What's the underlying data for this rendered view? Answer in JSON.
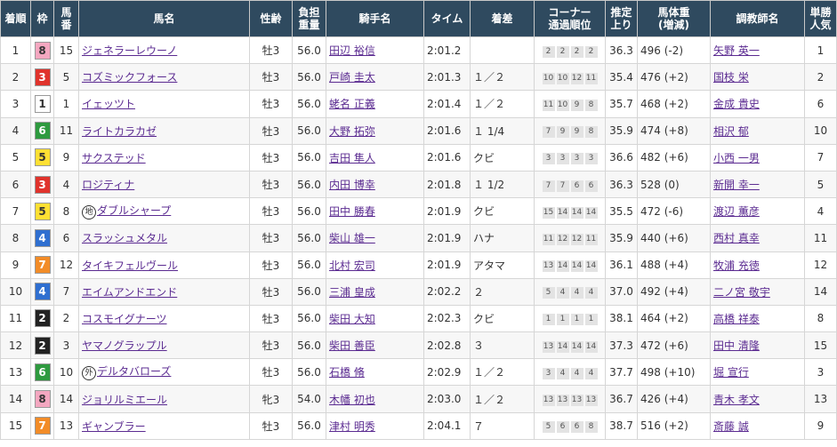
{
  "headers": {
    "rank": "着順",
    "waku": "枠",
    "umaban": "馬\n番",
    "horse": "馬名",
    "sexage": "性齢",
    "weight": "負担\n重量",
    "jockey": "騎手名",
    "time": "タイム",
    "margin": "着差",
    "corner": "コーナー\n通過順位",
    "last3f": "推定\n上り",
    "bodyweight": "馬体重\n(増減)",
    "trainer": "調教師名",
    "pop": "単勝\n人気"
  },
  "waku_colors": {
    "1": {
      "bg": "#ffffff",
      "fg": "#333333"
    },
    "2": {
      "bg": "#222222",
      "fg": "#ffffff"
    },
    "3": {
      "bg": "#e0332c",
      "fg": "#ffffff"
    },
    "4": {
      "bg": "#2f6fd0",
      "fg": "#ffffff"
    },
    "5": {
      "bg": "#ffe033",
      "fg": "#333333"
    },
    "6": {
      "bg": "#2e9a3f",
      "fg": "#ffffff"
    },
    "7": {
      "bg": "#f28c28",
      "fg": "#ffffff"
    },
    "8": {
      "bg": "#f4a7c0",
      "fg": "#333333"
    }
  },
  "rows": [
    {
      "rank": "1",
      "waku": "8",
      "umaban": "15",
      "mark": "",
      "horse": "ジェネラーレウーノ",
      "sexage": "牡3",
      "weight": "56.0",
      "jockey": "田辺 裕信",
      "time": "2:01.2",
      "margin": "",
      "corner": [
        "2",
        "2",
        "2",
        "2"
      ],
      "last3f": "36.3",
      "bodyweight": "496 (-2)",
      "trainer": "矢野 英一",
      "pop": "1"
    },
    {
      "rank": "2",
      "waku": "3",
      "umaban": "5",
      "mark": "",
      "horse": "コズミックフォース",
      "sexage": "牡3",
      "weight": "56.0",
      "jockey": "戸崎 圭太",
      "time": "2:01.3",
      "margin": "１／２",
      "corner": [
        "10",
        "10",
        "12",
        "11"
      ],
      "last3f": "35.4",
      "bodyweight": "476 (+2)",
      "trainer": "国枝 栄",
      "pop": "2"
    },
    {
      "rank": "3",
      "waku": "1",
      "umaban": "1",
      "mark": "",
      "horse": "イェッツト",
      "sexage": "牡3",
      "weight": "56.0",
      "jockey": "蛯名 正義",
      "time": "2:01.4",
      "margin": "１／２",
      "corner": [
        "11",
        "10",
        "9",
        "8"
      ],
      "last3f": "35.7",
      "bodyweight": "468 (+2)",
      "trainer": "金成 貴史",
      "pop": "6"
    },
    {
      "rank": "4",
      "waku": "6",
      "umaban": "11",
      "mark": "",
      "horse": "ライトカラカゼ",
      "sexage": "牡3",
      "weight": "56.0",
      "jockey": "大野 拓弥",
      "time": "2:01.6",
      "margin": "１ 1/4",
      "corner": [
        "7",
        "9",
        "9",
        "8"
      ],
      "last3f": "35.9",
      "bodyweight": "474 (+8)",
      "trainer": "相沢 郁",
      "pop": "10"
    },
    {
      "rank": "5",
      "waku": "5",
      "umaban": "9",
      "mark": "",
      "horse": "サクステッド",
      "sexage": "牡3",
      "weight": "56.0",
      "jockey": "吉田 隼人",
      "time": "2:01.6",
      "margin": "クビ",
      "corner": [
        "3",
        "3",
        "3",
        "3"
      ],
      "last3f": "36.6",
      "bodyweight": "482 (+6)",
      "trainer": "小西 一男",
      "pop": "7"
    },
    {
      "rank": "6",
      "waku": "3",
      "umaban": "4",
      "mark": "",
      "horse": "ロジティナ",
      "sexage": "牡3",
      "weight": "56.0",
      "jockey": "内田 博幸",
      "time": "2:01.8",
      "margin": "１ 1/2",
      "corner": [
        "7",
        "7",
        "6",
        "6"
      ],
      "last3f": "36.3",
      "bodyweight": "528 (0)",
      "trainer": "新開 幸一",
      "pop": "5"
    },
    {
      "rank": "7",
      "waku": "5",
      "umaban": "8",
      "mark": "地",
      "horse": "ダブルシャープ",
      "sexage": "牡3",
      "weight": "56.0",
      "jockey": "田中 勝春",
      "time": "2:01.9",
      "margin": "クビ",
      "corner": [
        "15",
        "14",
        "14",
        "14"
      ],
      "last3f": "35.5",
      "bodyweight": "472 (-6)",
      "trainer": "渡辺 薫彦",
      "pop": "4"
    },
    {
      "rank": "8",
      "waku": "4",
      "umaban": "6",
      "mark": "",
      "horse": "スラッシュメタル",
      "sexage": "牡3",
      "weight": "56.0",
      "jockey": "柴山 雄一",
      "time": "2:01.9",
      "margin": "ハナ",
      "corner": [
        "11",
        "12",
        "12",
        "11"
      ],
      "last3f": "35.9",
      "bodyweight": "440 (+6)",
      "trainer": "西村 真幸",
      "pop": "11"
    },
    {
      "rank": "9",
      "waku": "7",
      "umaban": "12",
      "mark": "",
      "horse": "タイキフェルヴール",
      "sexage": "牡3",
      "weight": "56.0",
      "jockey": "北村 宏司",
      "time": "2:01.9",
      "margin": "アタマ",
      "corner": [
        "13",
        "14",
        "14",
        "14"
      ],
      "last3f": "36.1",
      "bodyweight": "488 (+4)",
      "trainer": "牧浦 充徳",
      "pop": "12"
    },
    {
      "rank": "10",
      "waku": "4",
      "umaban": "7",
      "mark": "",
      "horse": "エイムアンドエンド",
      "sexage": "牡3",
      "weight": "56.0",
      "jockey": "三浦 皇成",
      "time": "2:02.2",
      "margin": "２",
      "corner": [
        "5",
        "4",
        "4",
        "4"
      ],
      "last3f": "37.0",
      "bodyweight": "492 (+4)",
      "trainer": "二ノ宮 敬宇",
      "pop": "14"
    },
    {
      "rank": "11",
      "waku": "2",
      "umaban": "2",
      "mark": "",
      "horse": "コスモイグナーツ",
      "sexage": "牡3",
      "weight": "56.0",
      "jockey": "柴田 大知",
      "time": "2:02.3",
      "margin": "クビ",
      "corner": [
        "1",
        "1",
        "1",
        "1"
      ],
      "last3f": "38.1",
      "bodyweight": "464 (+2)",
      "trainer": "高橋 祥泰",
      "pop": "8"
    },
    {
      "rank": "12",
      "waku": "2",
      "umaban": "3",
      "mark": "",
      "horse": "ヤマノグラップル",
      "sexage": "牡3",
      "weight": "56.0",
      "jockey": "柴田 善臣",
      "time": "2:02.8",
      "margin": "３",
      "corner": [
        "13",
        "14",
        "14",
        "14"
      ],
      "last3f": "37.3",
      "bodyweight": "472 (+6)",
      "trainer": "田中 清隆",
      "pop": "15"
    },
    {
      "rank": "13",
      "waku": "6",
      "umaban": "10",
      "mark": "外",
      "horse": "デルタバローズ",
      "sexage": "牡3",
      "weight": "56.0",
      "jockey": "石橋 脩",
      "time": "2:02.9",
      "margin": "１／２",
      "corner": [
        "3",
        "4",
        "4",
        "4"
      ],
      "last3f": "37.7",
      "bodyweight": "498 (+10)",
      "trainer": "堀 宣行",
      "pop": "3"
    },
    {
      "rank": "14",
      "waku": "8",
      "umaban": "14",
      "mark": "",
      "horse": "ジョリルミエール",
      "sexage": "牝3",
      "weight": "54.0",
      "jockey": "木幡 初也",
      "time": "2:03.0",
      "margin": "１／２",
      "corner": [
        "13",
        "13",
        "13",
        "13"
      ],
      "last3f": "36.7",
      "bodyweight": "426 (+4)",
      "trainer": "青木 孝文",
      "pop": "13"
    },
    {
      "rank": "15",
      "waku": "7",
      "umaban": "13",
      "mark": "",
      "horse": "ギャンブラー",
      "sexage": "牡3",
      "weight": "56.0",
      "jockey": "津村 明秀",
      "time": "2:04.1",
      "margin": "７",
      "corner": [
        "5",
        "6",
        "6",
        "8"
      ],
      "last3f": "38.7",
      "bodyweight": "516 (+2)",
      "trainer": "斎藤 誠",
      "pop": "9"
    }
  ]
}
